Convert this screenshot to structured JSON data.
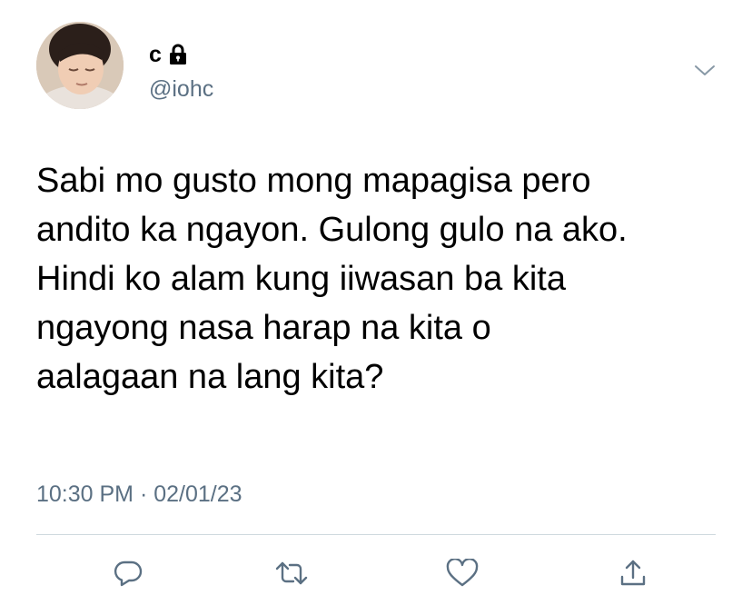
{
  "author": {
    "display_name": "c",
    "handle": "@iohc",
    "avatar_icon": "avatar-photo",
    "protected_icon": "lock-icon"
  },
  "tweet": {
    "text": "Sabi mo gusto mong mapagisa pero\nandito ka ngayon. Gulong gulo na ako.\nHindi ko alam kung iiwasan ba kita\nngayong nasa harap na kita o\naalagaan na lang kita?",
    "timestamp": "10:30 PM · 02/01/23"
  },
  "actions": [
    {
      "icon": "reply-icon"
    },
    {
      "icon": "retweet-icon"
    },
    {
      "icon": "like-icon"
    },
    {
      "icon": "share-icon"
    }
  ],
  "menu": {
    "icon": "chevron-down-icon"
  },
  "colors": {
    "text": "#000000",
    "secondary_text": "#5b7083",
    "divider": "#cfd9de",
    "background": "#ffffff"
  }
}
